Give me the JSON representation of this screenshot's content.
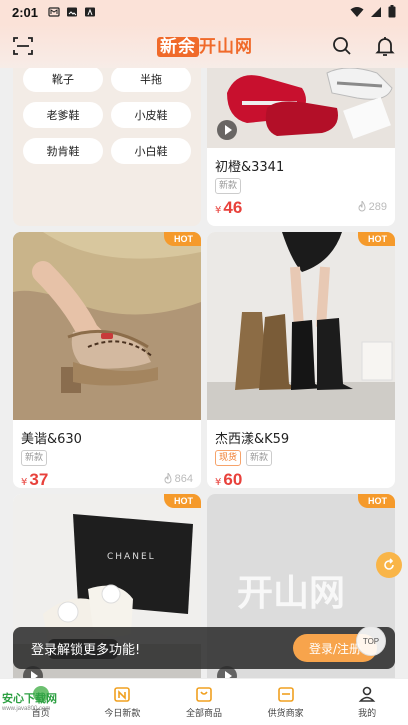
{
  "status": {
    "time": "2:01"
  },
  "header": {
    "logo_a": "新余",
    "logo_b": "开山网"
  },
  "categories": [
    "靴子",
    "半拖",
    "老爹鞋",
    "小皮鞋",
    "勃肯鞋",
    "小白鞋"
  ],
  "products": [
    {
      "name": "初橙&3341",
      "tags": [
        "新款"
      ],
      "currency": "¥",
      "price": "46",
      "hot": "289"
    },
    {
      "badge": "HOT",
      "name": "美谐&630",
      "tags": [
        "新款"
      ],
      "currency": "¥",
      "price": "37",
      "hot": "864"
    },
    {
      "badge": "HOT",
      "name": "杰西漾&K59",
      "tags": [
        "现货",
        "新款"
      ],
      "currency": "¥",
      "price": "60",
      "hot": ""
    },
    {
      "badge": "HOT",
      "brand": "CHANEL"
    },
    {
      "badge": "HOT",
      "watermark": "开山网"
    }
  ],
  "banner": {
    "text": "登录解锁更多功能!",
    "button": "登录/注册"
  },
  "top_button": "TOP",
  "nav": [
    {
      "label": "首页",
      "icon": "home-icon"
    },
    {
      "label": "今日新款",
      "icon": "calendar-new-icon"
    },
    {
      "label": "全部商品",
      "icon": "bag-icon"
    },
    {
      "label": "供货商家",
      "icon": "store-icon"
    },
    {
      "label": "我的",
      "icon": "user-icon"
    }
  ],
  "watermark": {
    "title": "安心下载网",
    "url": "www.java800.com"
  },
  "colors": {
    "accent": "#f06a2a",
    "price": "#e8413b",
    "hot": "#f59a2b"
  }
}
